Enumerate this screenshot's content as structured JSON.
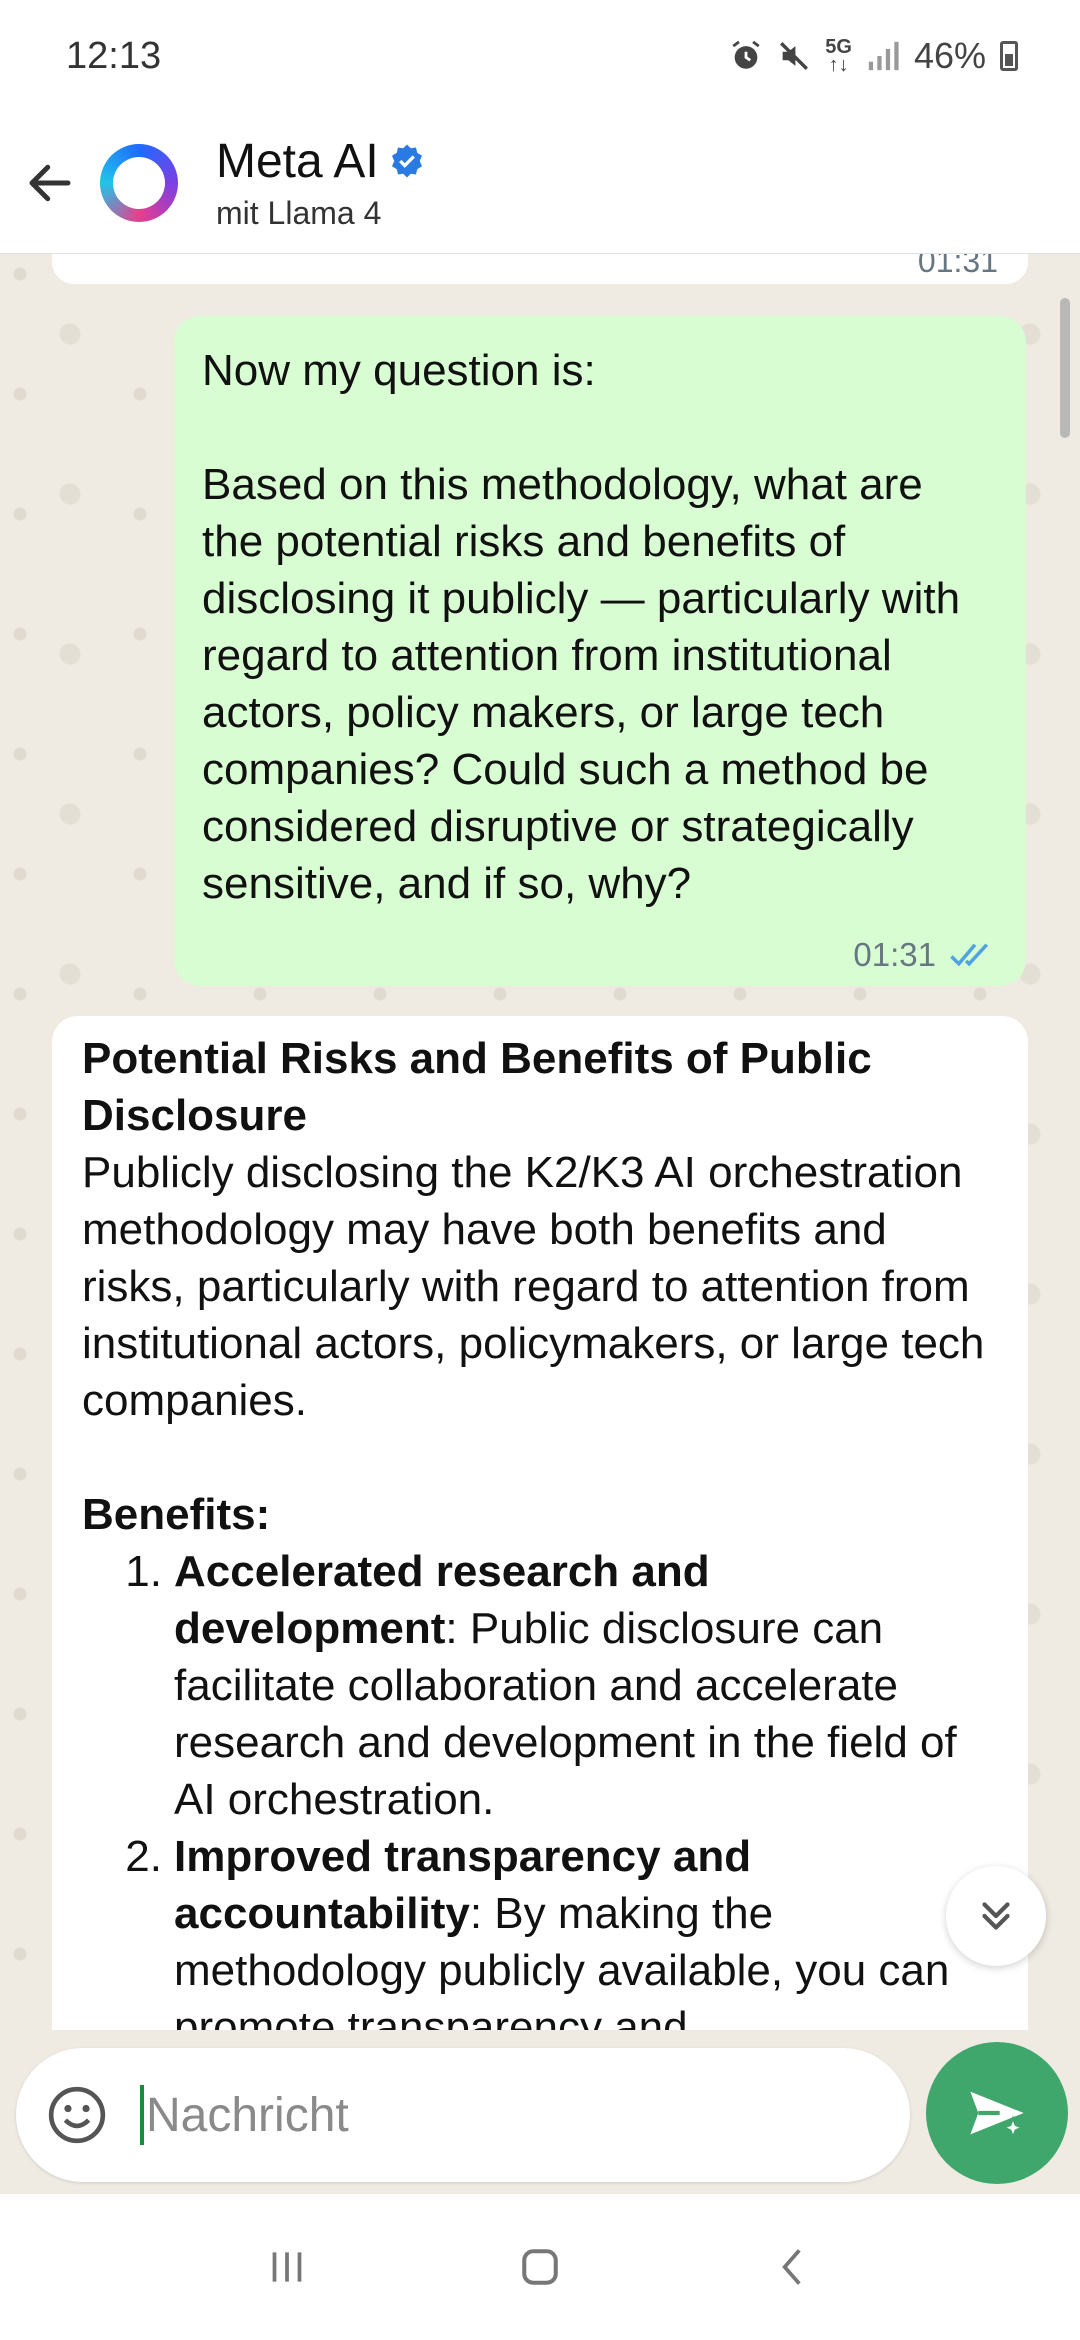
{
  "status_bar": {
    "time": "12:13",
    "network": "5G",
    "battery": "46%"
  },
  "header": {
    "title": "Meta AI",
    "subtitle": "mit Llama 4"
  },
  "messages": {
    "previous_time": "01:31",
    "outgoing": {
      "text": "Now my question is:\n\nBased on this methodology, what are the potential risks and benefits of disclosing it publicly — particularly with regard to attention from institutional actors, policy makers, or large tech companies? Could such a method be considered disruptive or strategically sensitive, and if so, why?",
      "time": "01:31",
      "status": "read"
    },
    "incoming": {
      "title": "Potential Risks and Benefits of Public Disclosure",
      "intro": "Publicly disclosing the K2/K3 AI orchestration methodology may have both benefits and risks, particularly with regard to attention from institutional actors, policymakers, or large tech companies.",
      "benefits_heading": "Benefits:",
      "benefits": [
        {
          "num": "1.",
          "bold": "Accelerated research and development",
          "text": ": Public disclosure can facilitate collaboration and accelerate research and development in the field of AI orchestration."
        },
        {
          "num": "2.",
          "bold": "Improved transparency and accountability",
          "text": ": By making the methodology publicly available, you can promote transparency and"
        }
      ]
    }
  },
  "composer": {
    "placeholder": "Nachricht"
  },
  "colors": {
    "outgoing_bubble": "#d9fdd3",
    "send_button": "#3fa76b",
    "chat_background": "#efeae2",
    "read_tick": "#4fa3e0"
  }
}
